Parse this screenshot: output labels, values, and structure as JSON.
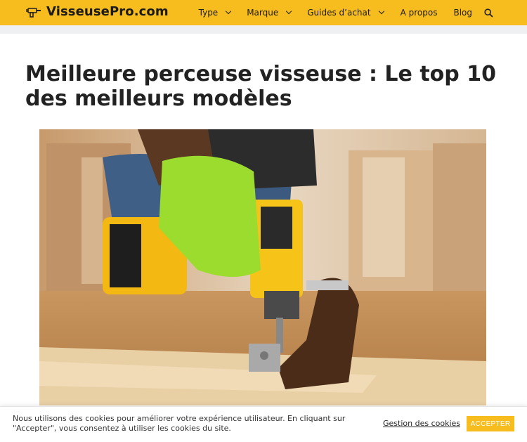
{
  "site": {
    "logo_text": "VisseusePro.com",
    "brand_color": "#f7bc1e"
  },
  "nav": {
    "items": [
      {
        "label": "Type",
        "has_dropdown": true
      },
      {
        "label": "Marque",
        "has_dropdown": true
      },
      {
        "label": "Guides d’achat",
        "has_dropdown": true
      },
      {
        "label": "A propos",
        "has_dropdown": false
      },
      {
        "label": "Blog",
        "has_dropdown": false
      }
    ],
    "search_icon": "search-icon"
  },
  "article": {
    "title": "Meilleure perceuse visseuse : Le top 10 des meilleurs modèles",
    "hero_image": "photo of a person using a yellow DeWalt cordless impact driver on wooden board, wearing green gloves"
  },
  "cookie_banner": {
    "text": "Nous utilisons des cookies pour améliorer votre expérience utilisateur. En cliquant sur \"Accepter\", vous consentez à utiliser les cookies du site.",
    "settings_label": "Gestion des cookies",
    "accept_label": "ACCEPTER"
  }
}
